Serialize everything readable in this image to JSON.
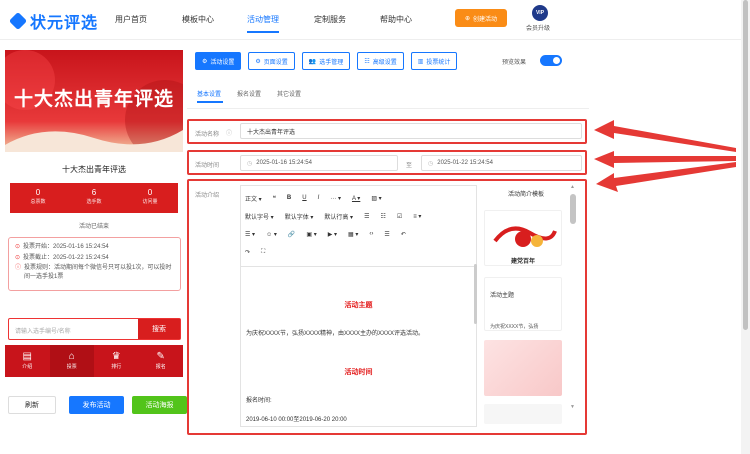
{
  "app": {
    "brand": "状元评选"
  },
  "nav": {
    "items": [
      {
        "label": "用户首页"
      },
      {
        "label": "模板中心"
      },
      {
        "label": "活动管理"
      },
      {
        "label": "定制服务"
      },
      {
        "label": "帮助中心"
      }
    ],
    "active_index": 2,
    "create_label": "创建活动",
    "vip_badge": "VIP",
    "vip_label": "会员升级"
  },
  "preview": {
    "banner_title": "十大杰出青年评选",
    "activity_name": "十大杰出青年评选",
    "stats": [
      {
        "value": "0",
        "label": "总票数"
      },
      {
        "value": "6",
        "label": "选手数"
      },
      {
        "value": "0",
        "label": "访问量"
      }
    ],
    "status": "活动已结束",
    "rules": [
      "投票开始：2025-01-16 15:24:54",
      "投票截止：2025-01-22 15:24:54",
      "投票规则：活动期间每个微信号只可以投1次，可以投时间一选手投1票"
    ],
    "search_placeholder": "请输入选手编号/名称",
    "search_button": "搜索",
    "tabbar": [
      {
        "icon": "▤",
        "label": "介绍"
      },
      {
        "icon": "⌂",
        "label": "投票"
      },
      {
        "icon": "♛",
        "label": "排行"
      },
      {
        "icon": "✎",
        "label": "报名"
      }
    ]
  },
  "actions": {
    "refresh": "刷新",
    "publish": "发布活动",
    "poster": "活动海报"
  },
  "settings": {
    "tabs": [
      {
        "label": "活动设置",
        "icon": "gear-icon"
      },
      {
        "label": "页面设置",
        "icon": "gear-icon"
      },
      {
        "label": "选手管理",
        "icon": "users-icon"
      },
      {
        "label": "高级设置",
        "icon": "sliders-icon"
      },
      {
        "label": "投票统计",
        "icon": "chart-icon"
      }
    ],
    "preview_effect_label": "预览效果",
    "preview_effect_on": true,
    "subtabs": [
      "基本设置",
      "报名设置",
      "其它设置"
    ],
    "name_label": "活动名称",
    "name_value": "十大杰出青年评选",
    "time_label": "活动时间",
    "start_time": "2025-01-16 15:24:54",
    "to_label": "至",
    "end_time": "2025-01-22 15:24:54",
    "intro_label": "活动介绍"
  },
  "editor": {
    "toolbar_row1": [
      "正文 ▾",
      "❝",
      "B",
      "U",
      "I",
      "··· ▾",
      "A ▾",
      "▨ ▾"
    ],
    "toolbar_row2": [
      "默认字号 ▾",
      "默认字体 ▾",
      "默认行高 ▾",
      "☰",
      "☷",
      "☑",
      "≡ ▾"
    ],
    "toolbar_row3": [
      "☰ ▾",
      "☺ ▾",
      "🔗",
      "▣ ▾",
      "▶ ▾",
      "▦ ▾",
      "‹›",
      "☰",
      "↶"
    ],
    "toolbar_row4": [
      "↷",
      "⛶"
    ],
    "content_title1": "活动主题",
    "content_para1": "为庆祝XXXX节，弘扬XXXX精神，由XXXX主办的XXXX评选活动。",
    "content_title2": "活动时间",
    "content_para2": "报名时间:",
    "content_para3": "2019-06-10 00:00至2019-06-20 20:00"
  },
  "templates": {
    "title": "活动简介模板",
    "items": [
      {
        "caption": "建党百年"
      },
      {
        "caption": "活动主题",
        "sub": "为庆祝XXXX节，弘扬"
      },
      {
        "caption": ""
      }
    ]
  },
  "colors": {
    "primary": "#1677ff",
    "accent": "#fa8c16",
    "danger": "#e53935",
    "preview_red": "#d81e1e",
    "success": "#52c41a"
  }
}
